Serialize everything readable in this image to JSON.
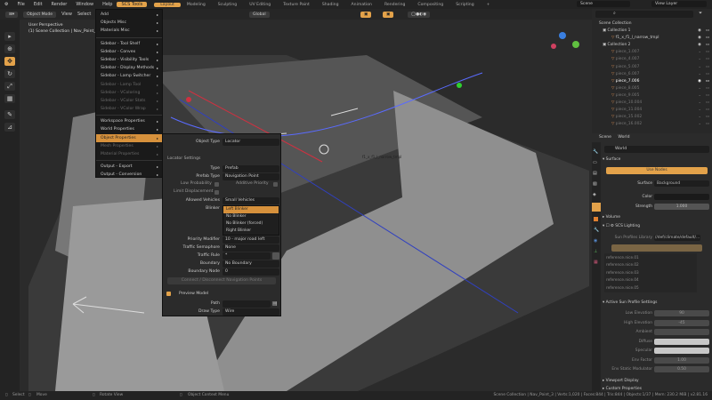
{
  "topbar": {
    "menus": [
      "File",
      "Edit",
      "Render",
      "Window",
      "Help",
      "SCS Tools"
    ],
    "workspaces": [
      "Layout",
      "Modeling",
      "Sculpting",
      "UV Editing",
      "Texture Paint",
      "Shading",
      "Animation",
      "Rendering",
      "Compositing",
      "Scripting"
    ],
    "scene": "Scene",
    "view_layer": "View Layer"
  },
  "header": {
    "mode": "Object Mode",
    "view": "View",
    "select": "Select",
    "orientation": "Global"
  },
  "viewport": {
    "perspective": "User Perspective",
    "context": "(1) Scene Collection | Nav_Point_3",
    "object_label": "f1_x_f1_l_narrow_tmpl"
  },
  "menu": {
    "items": [
      {
        "label": "Add",
        "state": "normal"
      },
      {
        "label": "Objects Misc",
        "state": "normal"
      },
      {
        "label": "Materials Misc",
        "state": "normal"
      },
      {
        "label": "Sidebar - Tool Shelf",
        "state": "normal"
      },
      {
        "label": "Sidebar - Convex",
        "state": "normal"
      },
      {
        "label": "Sidebar - Visibility Tools",
        "state": "normal"
      },
      {
        "label": "Sidebar - Display Methods",
        "state": "normal"
      },
      {
        "label": "Sidebar - Lamp Switcher",
        "state": "normal"
      },
      {
        "label": "Sidebar - Lamp Tool",
        "state": "disabled"
      },
      {
        "label": "Sidebar - VColoring",
        "state": "disabled"
      },
      {
        "label": "Sidebar - VColor Stats",
        "state": "disabled"
      },
      {
        "label": "Sidebar - VColor Wrap",
        "state": "disabled"
      },
      {
        "label": "Workspace Properties",
        "state": "normal"
      },
      {
        "label": "World Properties",
        "state": "normal"
      },
      {
        "label": "Object Properties",
        "state": "highlighted"
      },
      {
        "label": "Mesh Properties",
        "state": "disabled"
      },
      {
        "label": "Material Properties",
        "state": "disabled"
      },
      {
        "label": "Output - Export",
        "state": "normal"
      },
      {
        "label": "Output - Conversion",
        "state": "normal"
      }
    ]
  },
  "object_props": {
    "object_type_label": "Object Type",
    "object_type": "Locator",
    "section": "Locator Settings",
    "type_label": "Type",
    "type": "Prefab",
    "prefab_type_label": "Prefab Type",
    "prefab_type": "Navigation Point",
    "low_probability": "Low Probability",
    "additive_priority": "Additive Priority",
    "limit_displacement": "Limit Displacement",
    "allowed_vehicles_label": "Allowed Vehicles",
    "allowed_vehicles": "Small Vehicles",
    "blinker_label": "Blinker",
    "blinker_options": [
      "Left Blinker",
      "No Blinker",
      "No Blinker (forced)",
      "Right Blinker"
    ],
    "priority_modifier_label": "Priority Modifier",
    "priority_modifier": "10 - major road left",
    "traffic_semaphore_label": "Traffic Semaphore",
    "traffic_semaphore": "None",
    "traffic_rule_label": "Traffic Rule",
    "traffic_rule": "*",
    "boundary_label": "Boundary",
    "boundary": "No Boundary",
    "boundary_node_label": "Boundary Node",
    "boundary_node": "0",
    "connect_button": "Connect / Disconnect Navigation Points",
    "preview_model": "Preview Model",
    "path_label": "Path",
    "path": "",
    "draw_type_label": "Draw Type",
    "draw_type": "Wire"
  },
  "outliner": {
    "scene_collection": "Scene Collection",
    "rows": [
      {
        "name": "Collection 1",
        "level": 1,
        "style": "normal"
      },
      {
        "name": "f1_x_f1_l_narrow_tmpl",
        "level": 2,
        "style": "normal"
      },
      {
        "name": "Collection 2",
        "level": 1,
        "style": "normal"
      },
      {
        "name": "piece_1.007",
        "level": 2,
        "style": "dim"
      },
      {
        "name": "piece_4.007",
        "level": 2,
        "style": "dim"
      },
      {
        "name": "piece_5.007",
        "level": 2,
        "style": "dim"
      },
      {
        "name": "piece_6.007",
        "level": 2,
        "style": "dim"
      },
      {
        "name": "piece_7.006",
        "level": 2,
        "style": "selected"
      },
      {
        "name": "piece_8.005",
        "level": 2,
        "style": "dim"
      },
      {
        "name": "piece_9.005",
        "level": 2,
        "style": "dim"
      },
      {
        "name": "piece_10.004",
        "level": 2,
        "style": "dim"
      },
      {
        "name": "piece_11.004",
        "level": 2,
        "style": "dim"
      },
      {
        "name": "piece_15.002",
        "level": 2,
        "style": "dim"
      },
      {
        "name": "piece_16.002",
        "level": 2,
        "style": "dim"
      }
    ]
  },
  "properties": {
    "breadcrumb_scene": "Scene",
    "breadcrumb_world": "World",
    "world_name": "World",
    "surface": "Surface",
    "use_nodes": "Use Nodes",
    "surface_label": "Surface",
    "surface_value": "Background",
    "color_label": "Color",
    "strength_label": "Strength",
    "strength": "1.000",
    "volume": "Volume",
    "scs_lighting": "SCS Lighting",
    "sun_lib_label": "Sun Profiles Library",
    "sun_lib": "//def/climate/default/...",
    "sun_profiles": [
      "reference.nice.01",
      "reference.nice.02",
      "reference.nice.03",
      "reference.nice.04",
      "reference.nice.05"
    ],
    "active_sun": "Active Sun Profile Settings",
    "sun_settings": [
      {
        "label": "Low Elevation",
        "value": "90"
      },
      {
        "label": "High Elevation",
        "value": "-45"
      },
      {
        "label": "Ambient",
        "value": ""
      },
      {
        "label": "Diffuse",
        "value": ""
      },
      {
        "label": "Specular",
        "value": ""
      },
      {
        "label": "Env Factor",
        "value": "1.00"
      },
      {
        "label": "Env Static Modulator",
        "value": "0.50"
      }
    ],
    "viewport_display": "Viewport Display",
    "custom_properties": "Custom Properties"
  },
  "status": {
    "select": "Select",
    "move": "Move",
    "rotate": "Rotate View",
    "context_menu": "Object Context Menu",
    "stats": "Scene Collection | Nav_Point_3 | Verts:1,020 | Faces:844 | Tris:844 | Objects:1/37 | Mem: 230.2 MiB | v2.81.16"
  },
  "colors": {
    "accent": "#e3a24a",
    "bg": "#1d1d1d",
    "panel": "#2b2b2b"
  }
}
